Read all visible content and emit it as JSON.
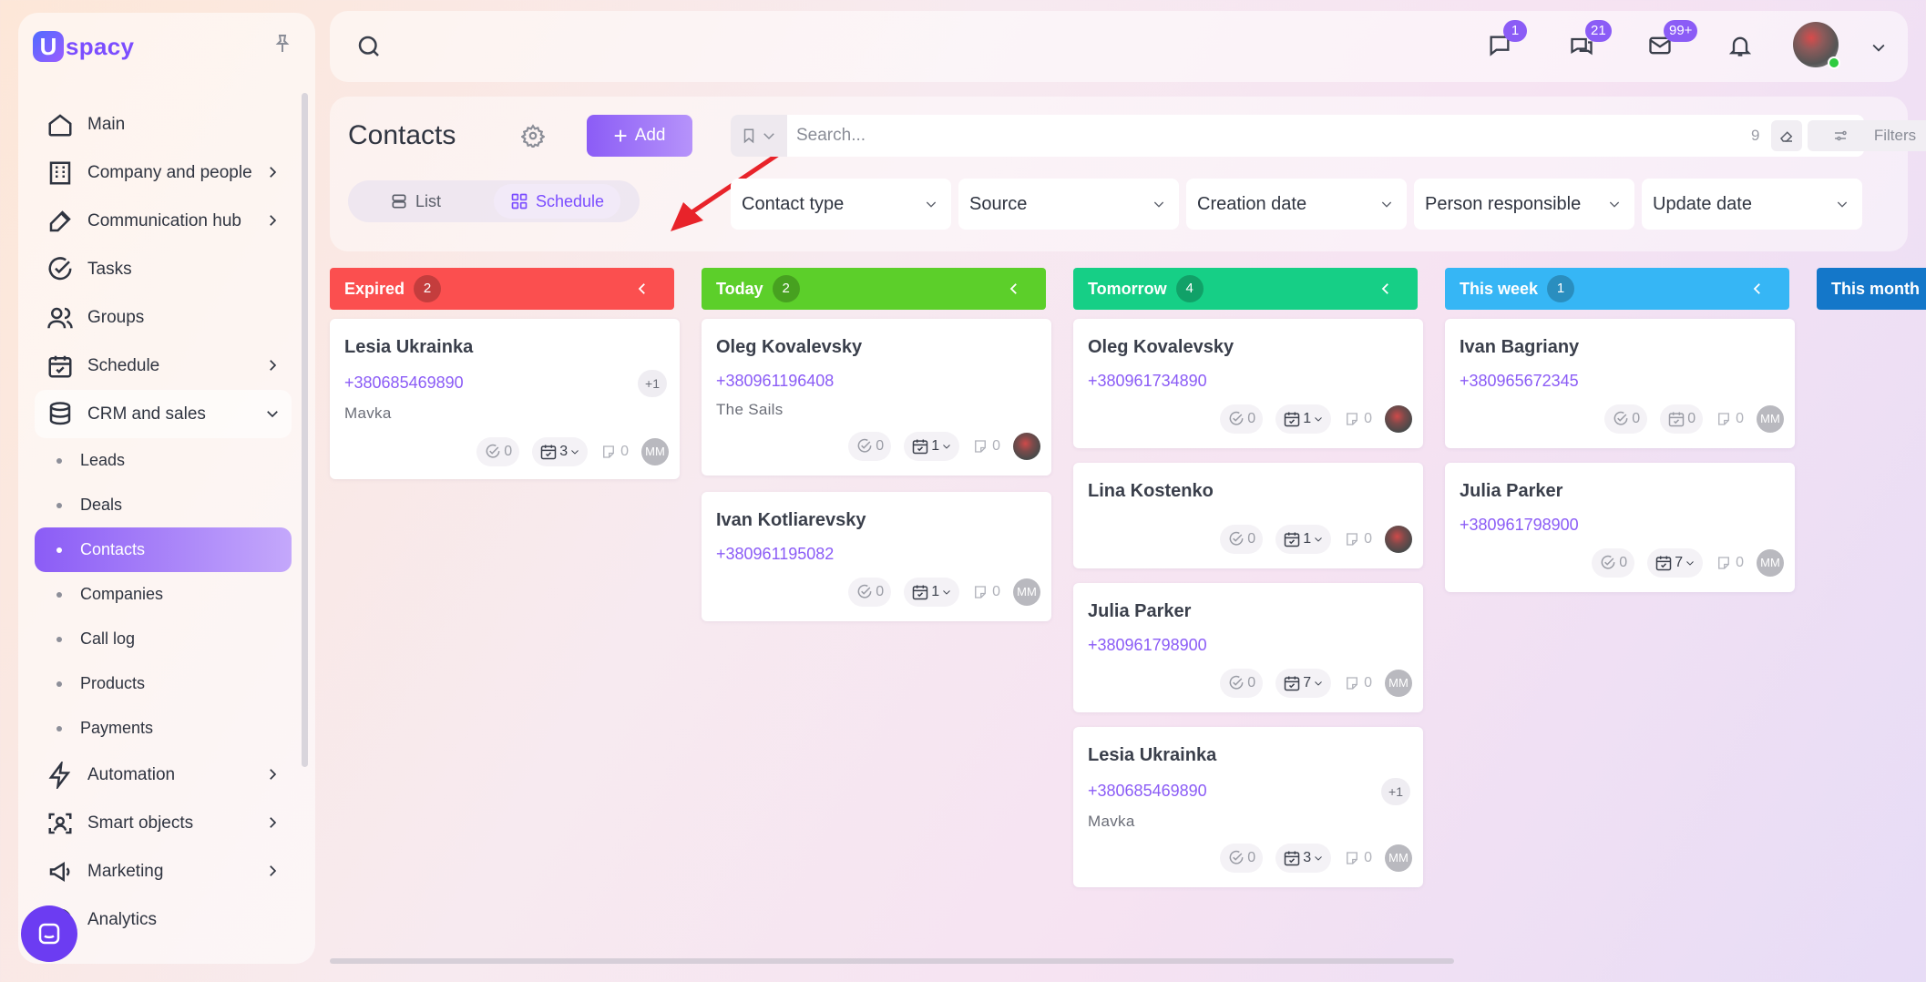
{
  "brand": {
    "logo_letter": "U",
    "logo_text": "spacy"
  },
  "sidebar": {
    "items": [
      {
        "label": "Main",
        "icon": "home-icon"
      },
      {
        "label": "Company and people",
        "icon": "building-icon"
      },
      {
        "label": "Communication hub",
        "icon": "edit-icon"
      },
      {
        "label": "Tasks",
        "icon": "check-circle-icon"
      },
      {
        "label": "Groups",
        "icon": "users-icon"
      },
      {
        "label": "Schedule",
        "icon": "calendar-icon"
      },
      {
        "label": "CRM and sales",
        "icon": "database-icon"
      }
    ],
    "sub_items": [
      {
        "label": "Leads"
      },
      {
        "label": "Deals"
      },
      {
        "label": "Contacts"
      },
      {
        "label": "Companies"
      },
      {
        "label": "Call log"
      },
      {
        "label": "Products"
      },
      {
        "label": "Payments"
      }
    ],
    "bottom_items": [
      {
        "label": "Automation",
        "icon": "bolt-icon"
      },
      {
        "label": "Smart objects",
        "icon": "scan-icon"
      },
      {
        "label": "Marketing",
        "icon": "megaphone-icon"
      },
      {
        "label": "Analytics",
        "icon": "chart-icon"
      }
    ]
  },
  "topbar": {
    "badges": {
      "chat": "1",
      "messages": "21",
      "mail": "99+"
    }
  },
  "header": {
    "title": "Contacts",
    "add_label": "Add",
    "view_list": "List",
    "view_schedule": "Schedule",
    "search_placeholder": "Search...",
    "search_count": "9",
    "filters_label": "Filters",
    "filters": [
      "Contact type",
      "Source",
      "Creation date",
      "Person responsible",
      "Update date"
    ]
  },
  "columns": [
    {
      "title": "Expired",
      "count": "2",
      "color": "#fb4f4f"
    },
    {
      "title": "Today",
      "count": "2",
      "color": "#5ccf2a"
    },
    {
      "title": "Tomorrow",
      "count": "4",
      "color": "#16cf86"
    },
    {
      "title": "This week",
      "count": "1",
      "color": "#36b6f5"
    },
    {
      "title": "This month",
      "count": "",
      "color": "#1477c9"
    }
  ],
  "cards": {
    "expired": [
      {
        "name": "Lesia Ukrainka",
        "phone": "+380685469890",
        "sub": "Mavka",
        "more": "+1",
        "tasks": "0",
        "events": "3",
        "notes": "0",
        "avatar": "MM"
      }
    ],
    "today": [
      {
        "name": "Oleg Kovalevsky",
        "phone": "+380961196408",
        "sub": "The Sails",
        "tasks": "0",
        "events": "1",
        "notes": "0"
      },
      {
        "name": "Ivan Kotliarevsky",
        "phone": "+380961195082",
        "tasks": "0",
        "events": "1",
        "notes": "0",
        "avatar": "MM"
      }
    ],
    "tomorrow": [
      {
        "name": "Oleg Kovalevsky",
        "phone": "+380961734890",
        "tasks": "0",
        "events": "1",
        "notes": "0"
      },
      {
        "name": "Lina Kostenko",
        "tasks": "0",
        "events": "1",
        "notes": "0"
      },
      {
        "name": "Julia Parker",
        "phone": "+380961798900",
        "tasks": "0",
        "events": "7",
        "notes": "0",
        "avatar": "MM"
      },
      {
        "name": "Lesia Ukrainka",
        "phone": "+380685469890",
        "sub": "Mavka",
        "more": "+1",
        "tasks": "0",
        "events": "3",
        "notes": "0",
        "avatar": "MM"
      }
    ],
    "week": [
      {
        "name": "Ivan Bagriany",
        "phone": "+380965672345",
        "tasks": "0",
        "events": "0",
        "notes": "0",
        "avatar": "MM"
      },
      {
        "name": "Julia Parker",
        "phone": "+380961798900",
        "tasks": "0",
        "events": "7",
        "notes": "0",
        "avatar": "MM"
      }
    ]
  }
}
